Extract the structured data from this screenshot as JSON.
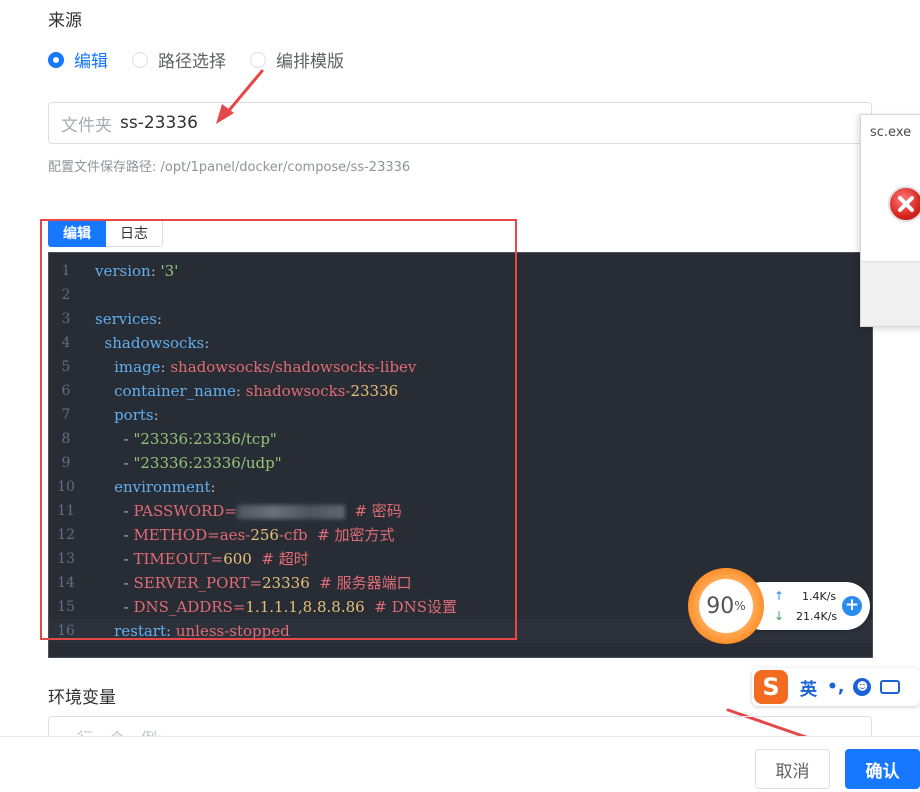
{
  "source": {
    "label": "来源",
    "options": [
      {
        "label": "编辑",
        "selected": true
      },
      {
        "label": "路径选择",
        "selected": false
      },
      {
        "label": "编排模版",
        "selected": false
      }
    ]
  },
  "folder": {
    "prefix": "文件夹",
    "value": "ss-23336"
  },
  "path_hint": "配置文件保存路径: /opt/1panel/docker/compose/ss-23336",
  "editor": {
    "tabs": [
      "编辑",
      "日志"
    ],
    "lines": [
      {
        "num": "1",
        "html": "<span class=\"k\">version</span>: <span class=\"s\">'3'</span>"
      },
      {
        "num": "2",
        "html": ""
      },
      {
        "num": "3",
        "html": "<span class=\"k\">services</span>:"
      },
      {
        "num": "4",
        "html": "  <span class=\"k\">shadowsocks</span>:"
      },
      {
        "num": "5",
        "html": "    <span class=\"k\">image</span>: <span class=\"v\">shadowsocks/shadowsocks-libev</span>"
      },
      {
        "num": "6",
        "html": "    <span class=\"k\">container_name</span>: <span class=\"v\">shadowsocks-</span><span class=\"n\">23336</span>"
      },
      {
        "num": "7",
        "html": "    <span class=\"k\">ports</span>:"
      },
      {
        "num": "8",
        "html": "      - <span class=\"s\">\"23336:23336/tcp\"</span>"
      },
      {
        "num": "9",
        "html": "      - <span class=\"s\">\"23336:23336/udp\"</span>"
      },
      {
        "num": "10",
        "html": "    <span class=\"k\">environment</span>:"
      },
      {
        "num": "11",
        "html": "      - <span class=\"v\">PASSWORD=</span><span class=\"blur\"></span>  <span class=\"c\"># 密码</span>"
      },
      {
        "num": "12",
        "html": "      - <span class=\"v\">METHOD=aes-</span><span class=\"n\">256</span><span class=\"v\">-cfb</span>  <span class=\"c\"># 加密方式</span>"
      },
      {
        "num": "13",
        "html": "      - <span class=\"v\">TIMEOUT=</span><span class=\"n\">600</span>  <span class=\"c\"># 超时</span>"
      },
      {
        "num": "14",
        "html": "      - <span class=\"v\">SERVER_PORT=</span><span class=\"n\">23336</span>  <span class=\"c\"># 服务器端口</span>"
      },
      {
        "num": "15",
        "html": "      - <span class=\"v\">DNS_ADDRS=</span><span class=\"n\">1.1.1.1,8.8.8.86</span>  <span class=\"c\"># DNS设置</span>"
      },
      {
        "num": "16",
        "html": "    <span class=\"k\">restart</span>: <span class=\"v\">unless-stopped</span>"
      }
    ],
    "active_line": 16
  },
  "error_dialog": {
    "title": "sc.exe"
  },
  "speed_widget": {
    "percent": "90",
    "percent_sign": "%",
    "upload": "1.4K/s",
    "download": "21.4K/s",
    "up_icon": "arrow-up-icon",
    "down_icon": "arrow-down-icon"
  },
  "ime": {
    "logo": "S",
    "lang": "英",
    "punct": "•,",
    "emoji": "☻",
    "keyboard": "⌨"
  },
  "env": {
    "label": "环境变量",
    "placeholder": "一行一个，例:"
  },
  "buttons": {
    "cancel": "取消",
    "confirm": "确认"
  },
  "colors": {
    "primary": "#1677ff",
    "annotation": "#e54848",
    "editor_bg": "#282c34"
  }
}
